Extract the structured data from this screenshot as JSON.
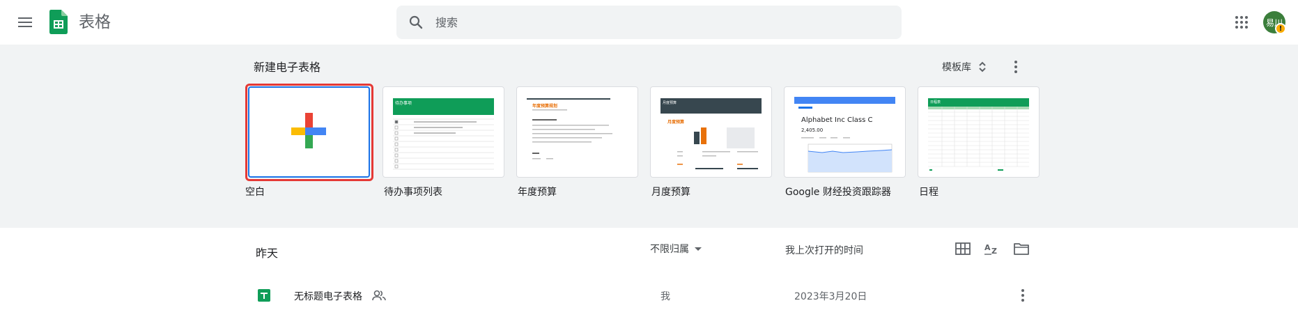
{
  "header": {
    "app_name": "表格",
    "search_placeholder": "搜索",
    "avatar_initials": "易川",
    "avatar_badge": "!"
  },
  "templates": {
    "section_title": "新建电子表格",
    "gallery_label": "模板库",
    "items": [
      {
        "label": "空白"
      },
      {
        "label": "待办事项列表"
      },
      {
        "label": "年度预算"
      },
      {
        "label": "月度预算"
      },
      {
        "label": "Google 财经投资跟踪器"
      },
      {
        "label": "日程"
      }
    ],
    "previews": {
      "todo_title": "待办事项",
      "annual_title": "年度预算规划",
      "monthly_title": "月度预算",
      "finance_title": "Alphabet Inc Class C",
      "finance_price": "2,405.00",
      "schedule_title": "日程表"
    }
  },
  "recent": {
    "period": "昨天",
    "owner_filter": "不限归属",
    "sort_label": "我上次打开的时间",
    "files": [
      {
        "name": "无标题电子表格",
        "owner": "我",
        "date": "2023年3月20日"
      }
    ]
  },
  "colors": {
    "sheets_green": "#0f9d58",
    "google_blue": "#4285f4",
    "google_red": "#ea4335",
    "google_yellow": "#fbbc04",
    "google_green": "#34a853",
    "highlight_red": "#e53935"
  },
  "icons": {
    "menu": "hamburger-menu-icon",
    "logo": "sheets-logo-icon",
    "search": "search-icon",
    "apps": "apps-grid-icon",
    "expand": "unfold-icon",
    "more": "more-vert-icon",
    "grid_view": "grid-view-icon",
    "sort": "sort-az-icon",
    "folder": "folder-icon",
    "shared": "shared-people-icon"
  }
}
